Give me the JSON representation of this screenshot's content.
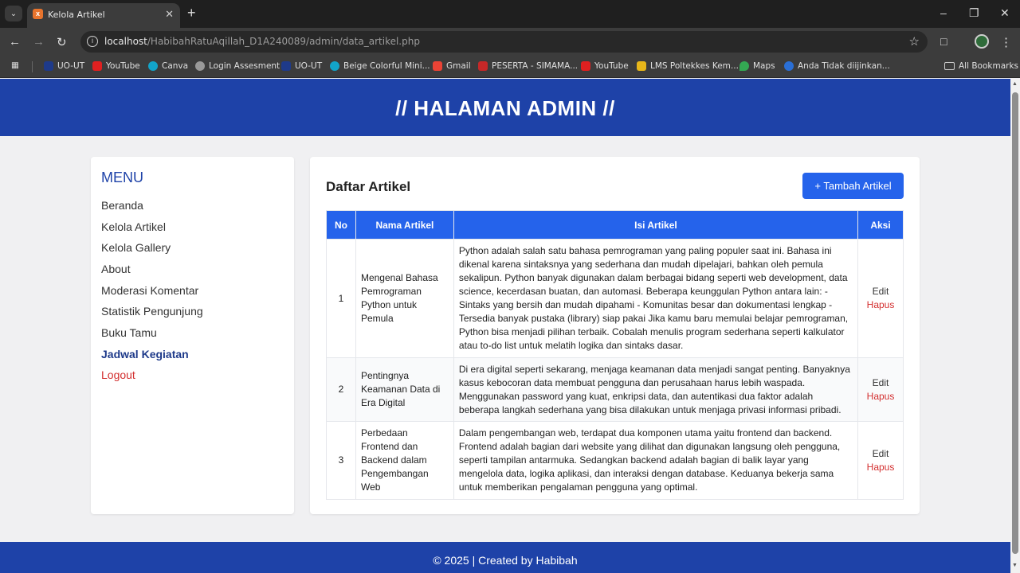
{
  "browser": {
    "tab_title": "Kelola Artikel",
    "url_host": "localhost",
    "url_path": "/HabibahRatuAqillah_D1A240089/admin/data_artikel.php",
    "bookmarks": [
      "UO-UT",
      "YouTube",
      "Canva",
      "Login Assesment",
      "UO-UT",
      "Beige Colorful Mini...",
      "Gmail",
      "PESERTA - SIMAMA...",
      "YouTube",
      "LMS Poltekkes Kem...",
      "Maps",
      "Anda Tidak diijinkan..."
    ],
    "all_bookmarks": "All Bookmarks"
  },
  "header": {
    "title": "// HALAMAN ADMIN //"
  },
  "sidebar": {
    "title": "MENU",
    "items": [
      "Beranda",
      "Kelola Artikel",
      "Kelola Gallery",
      "About",
      "Moderasi Komentar",
      "Statistik Pengunjung",
      "Buku Tamu",
      "Jadwal Kegiatan",
      "Logout"
    ]
  },
  "main": {
    "title": "Daftar Artikel",
    "add_button": "+ Tambah Artikel",
    "columns": [
      "No",
      "Nama Artikel",
      "Isi Artikel",
      "Aksi"
    ],
    "rows": [
      {
        "no": "1",
        "name": "Mengenal Bahasa Pemrograman Python untuk Pemula",
        "content": "Python adalah salah satu bahasa pemrograman yang paling populer saat ini. Bahasa ini dikenal karena sintaksnya yang sederhana dan mudah dipelajari, bahkan oleh pemula sekalipun. Python banyak digunakan dalam berbagai bidang seperti web development, data science, kecerdasan buatan, dan automasi. Beberapa keunggulan Python antara lain: - Sintaks yang bersih dan mudah dipahami - Komunitas besar dan dokumentasi lengkap - Tersedia banyak pustaka (library) siap pakai Jika kamu baru memulai belajar pemrograman, Python bisa menjadi pilihan terbaik. Cobalah menulis program sederhana seperti kalkulator atau to-do list untuk melatih logika dan sintaks dasar."
      },
      {
        "no": "2",
        "name": "Pentingnya Keamanan Data di Era Digital",
        "content": "Di era digital seperti sekarang, menjaga keamanan data menjadi sangat penting. Banyaknya kasus kebocoran data membuat pengguna dan perusahaan harus lebih waspada. Menggunakan password yang kuat, enkripsi data, dan autentikasi dua faktor adalah beberapa langkah sederhana yang bisa dilakukan untuk menjaga privasi informasi pribadi."
      },
      {
        "no": "3",
        "name": "Perbedaan Frontend dan Backend dalam Pengembangan Web",
        "content": "Dalam pengembangan web, terdapat dua komponen utama yaitu frontend dan backend. Frontend adalah bagian dari website yang dilihat dan digunakan langsung oleh pengguna, seperti tampilan antarmuka. Sedangkan backend adalah bagian di balik layar yang mengelola data, logika aplikasi, dan interaksi dengan database. Keduanya bekerja sama untuk memberikan pengalaman pengguna yang optimal."
      }
    ],
    "edit_label": "Edit",
    "delete_label": "Hapus"
  },
  "footer": {
    "text": "© 2025 | Created by Habibah"
  },
  "colors": {
    "header_bg": "#1e42a8",
    "table_header": "#2563eb",
    "delete": "#d32f2f"
  }
}
